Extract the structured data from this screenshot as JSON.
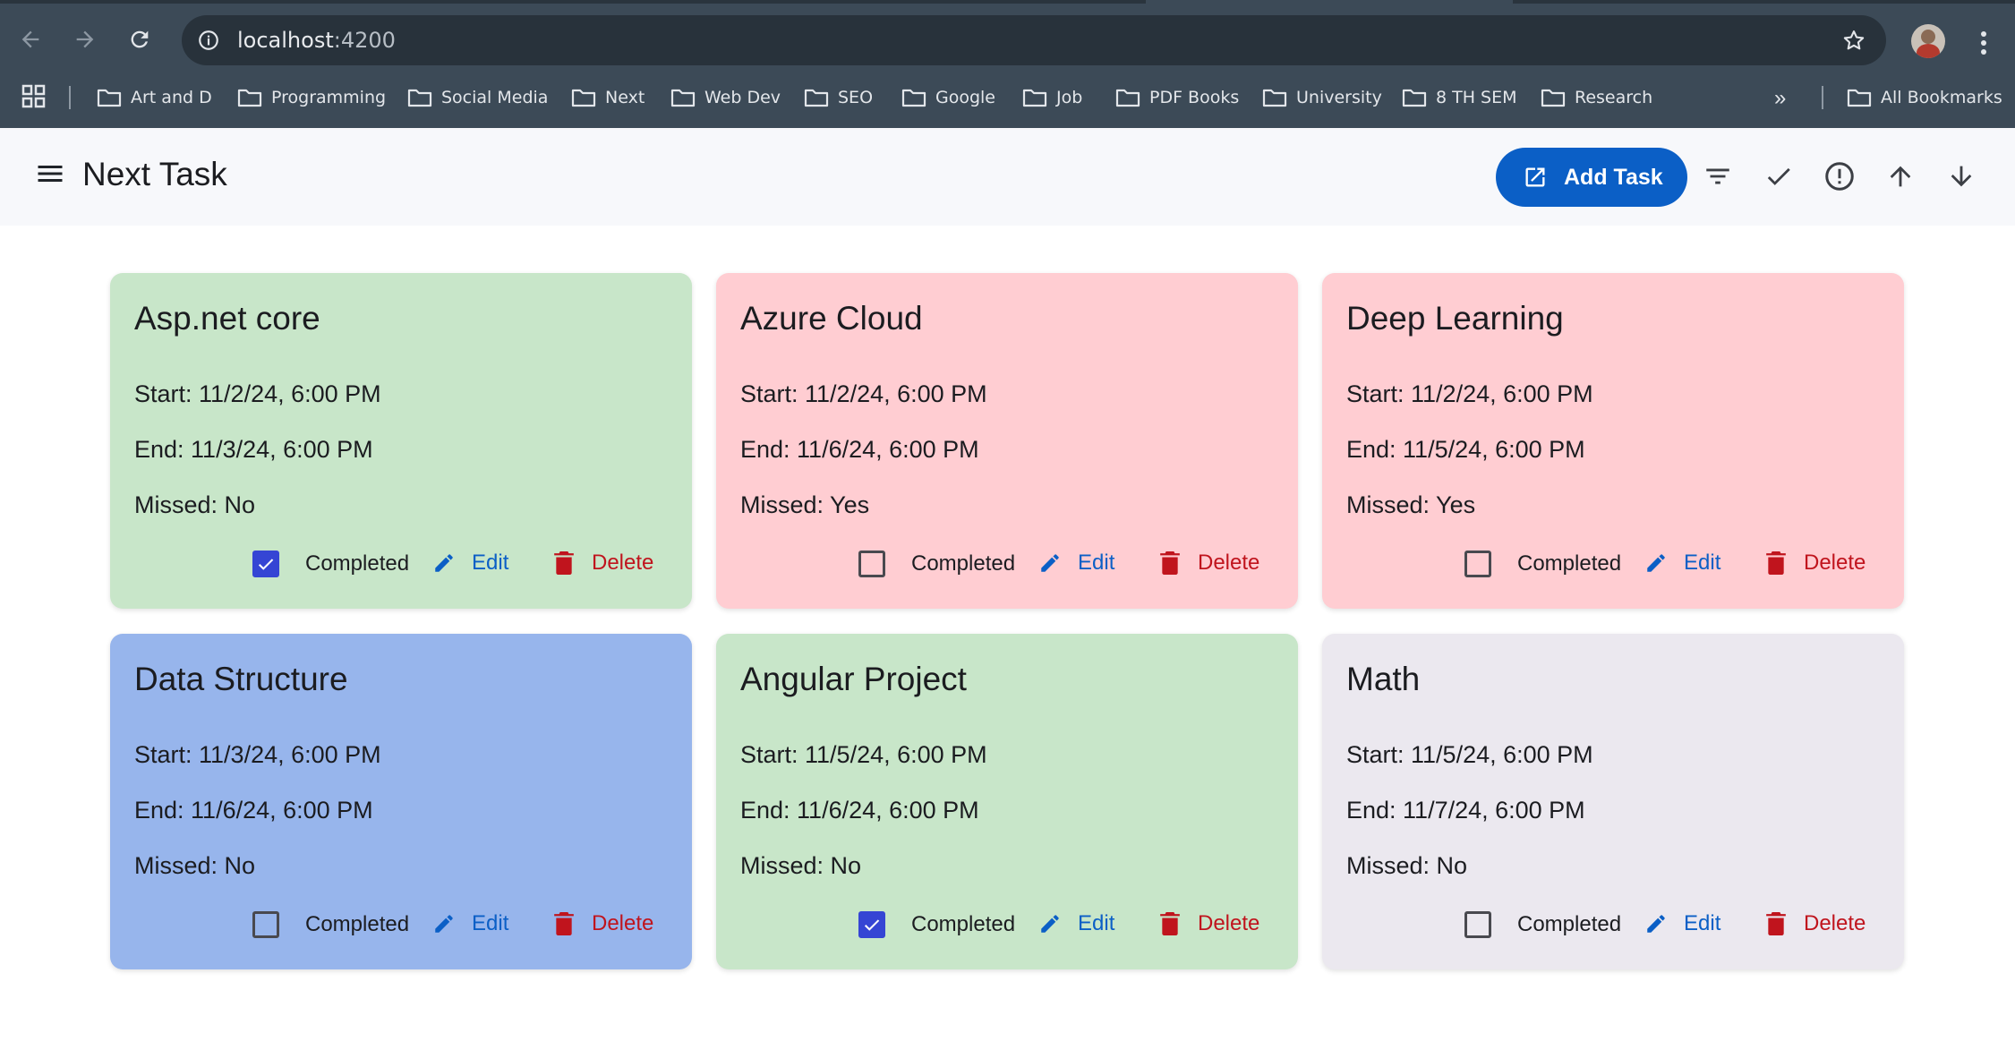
{
  "browser": {
    "url_host": "localhost",
    "url_port": ":4200",
    "bookmarks": [
      {
        "label": "Art and D"
      },
      {
        "label": "Programming"
      },
      {
        "label": "Social Media"
      },
      {
        "label": "Next"
      },
      {
        "label": "Web Dev"
      },
      {
        "label": "SEO"
      },
      {
        "label": "Google"
      },
      {
        "label": "Job"
      },
      {
        "label": "PDF Books"
      },
      {
        "label": "University"
      },
      {
        "label": "8 TH SEM"
      },
      {
        "label": "Research"
      }
    ],
    "overflow": "»",
    "all_bookmarks": "All Bookmarks"
  },
  "toolbar": {
    "title": "Next Task",
    "add_label": "Add Task"
  },
  "colors": {
    "green": "#c8e6c9",
    "red": "#ffcdd2",
    "blue": "#97b5ec",
    "gray": "#ebe8ef",
    "primary": "#0b5fc6",
    "danger": "#c0141d"
  },
  "labels": {
    "completed": "Completed",
    "edit": "Edit",
    "delete": "Delete"
  },
  "tasks": [
    {
      "title": "Asp.net core",
      "start": "Start: 11/2/24, 6:00 PM",
      "end": "End: 11/3/24, 6:00 PM",
      "missed": "Missed: No",
      "completed": true,
      "color": "green"
    },
    {
      "title": "Azure Cloud",
      "start": "Start: 11/2/24, 6:00 PM",
      "end": "End: 11/6/24, 6:00 PM",
      "missed": "Missed: Yes",
      "completed": false,
      "color": "red"
    },
    {
      "title": "Deep Learning",
      "start": "Start: 11/2/24, 6:00 PM",
      "end": "End: 11/5/24, 6:00 PM",
      "missed": "Missed: Yes",
      "completed": false,
      "color": "red"
    },
    {
      "title": "Data Structure",
      "start": "Start: 11/3/24, 6:00 PM",
      "end": "End: 11/6/24, 6:00 PM",
      "missed": "Missed: No",
      "completed": false,
      "color": "blue"
    },
    {
      "title": "Angular Project",
      "start": "Start: 11/5/24, 6:00 PM",
      "end": "End: 11/6/24, 6:00 PM",
      "missed": "Missed: No",
      "completed": true,
      "color": "green"
    },
    {
      "title": "Math",
      "start": "Start: 11/5/24, 6:00 PM",
      "end": "End: 11/7/24, 6:00 PM",
      "missed": "Missed: No",
      "completed": false,
      "color": "gray"
    }
  ]
}
